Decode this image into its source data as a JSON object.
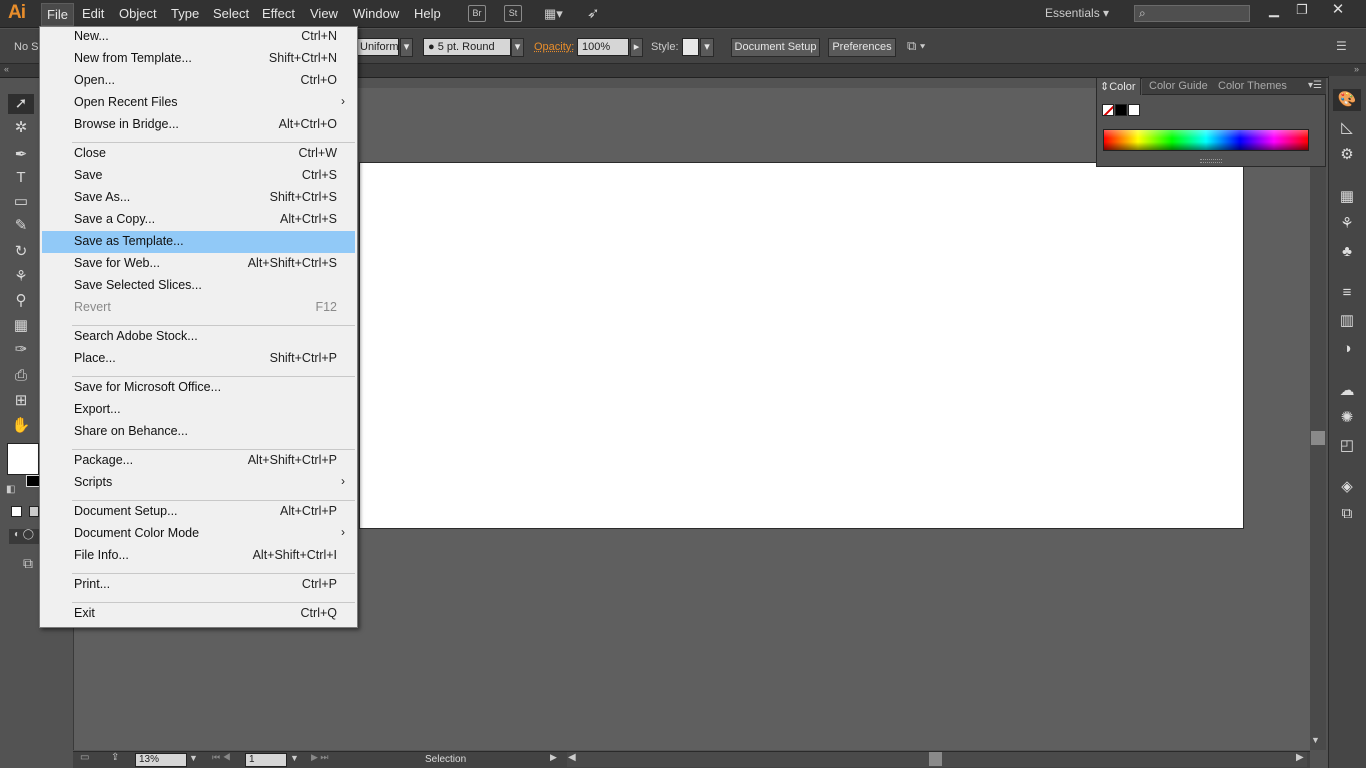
{
  "app": {
    "logo": "Ai",
    "menus": [
      "File",
      "Edit",
      "Object",
      "Type",
      "Select",
      "Effect",
      "View",
      "Window",
      "Help"
    ],
    "bridge_label": "Br",
    "stock_label": "St",
    "workspace": "Essentials",
    "workspace_arrow": "▾"
  },
  "controlbar": {
    "no_selection": "No Se",
    "stroke_profile": "Uniform",
    "brush": "5 pt. Round",
    "opacity_label": "Opacity:",
    "opacity_value": "100%",
    "style_label": "Style:",
    "document_setup": "Document Setup",
    "preferences": "Preferences"
  },
  "color_panel": {
    "tabs": [
      "Color",
      "Color Guide",
      "Color Themes"
    ]
  },
  "statusbar": {
    "zoom": "13%",
    "page": "1",
    "mode": "Selection"
  },
  "file_menu": {
    "items": [
      {
        "label": "New...",
        "shortcut": "Ctrl+N"
      },
      {
        "label": "New from Template...",
        "shortcut": "Shift+Ctrl+N"
      },
      {
        "label": "Open...",
        "shortcut": "Ctrl+O"
      },
      {
        "label": "Open Recent Files",
        "shortcut": "",
        "submenu": true
      },
      {
        "label": "Browse in Bridge...",
        "shortcut": "Alt+Ctrl+O"
      },
      {
        "label": "Close",
        "shortcut": "Ctrl+W"
      },
      {
        "label": "Save",
        "shortcut": "Ctrl+S"
      },
      {
        "label": "Save As...",
        "shortcut": "Shift+Ctrl+S"
      },
      {
        "label": "Save a Copy...",
        "shortcut": "Alt+Ctrl+S"
      },
      {
        "label": "Save as Template...",
        "shortcut": "",
        "highlight": true
      },
      {
        "label": "Save for Web...",
        "shortcut": "Alt+Shift+Ctrl+S"
      },
      {
        "label": "Save Selected Slices...",
        "shortcut": ""
      },
      {
        "label": "Revert",
        "shortcut": "F12",
        "disabled": true
      },
      {
        "label": "Search Adobe Stock...",
        "shortcut": ""
      },
      {
        "label": "Place...",
        "shortcut": "Shift+Ctrl+P"
      },
      {
        "label": "Save for Microsoft Office...",
        "shortcut": ""
      },
      {
        "label": "Export...",
        "shortcut": ""
      },
      {
        "label": "Share on Behance...",
        "shortcut": ""
      },
      {
        "label": "Package...",
        "shortcut": "Alt+Shift+Ctrl+P"
      },
      {
        "label": "Scripts",
        "shortcut": "",
        "submenu": true
      },
      {
        "label": "Document Setup...",
        "shortcut": "Alt+Ctrl+P"
      },
      {
        "label": "Document Color Mode",
        "shortcut": "",
        "submenu": true
      },
      {
        "label": "File Info...",
        "shortcut": "Alt+Shift+Ctrl+I"
      },
      {
        "label": "Print...",
        "shortcut": "Ctrl+P"
      },
      {
        "label": "Exit",
        "shortcut": "Ctrl+Q"
      }
    ]
  }
}
